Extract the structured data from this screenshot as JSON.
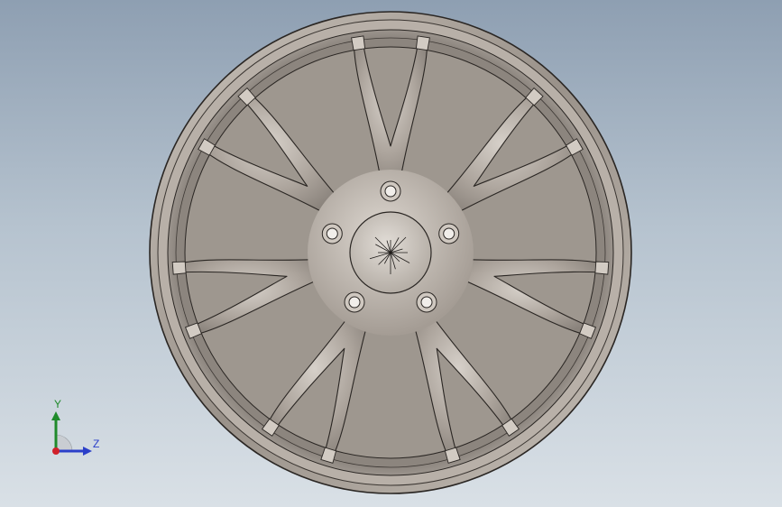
{
  "viewport": {
    "background_top": "#8e9fb2",
    "background_bottom": "#d9e0e6"
  },
  "model": {
    "part": "wheel-rim",
    "spoke_pairs": 7,
    "lug_holes": 5,
    "colors": {
      "metal_light": "#d2cbc3",
      "metal_mid": "#aaa29a",
      "metal_dark": "#6f6962",
      "edge": "#2a2623"
    }
  },
  "triad": {
    "y_label": "Y",
    "z_label": "Z",
    "colors": {
      "y": "#1f8a2b",
      "z": "#2b3fc9",
      "x": "#d0202a"
    },
    "icon": "view-orientation-triad"
  }
}
